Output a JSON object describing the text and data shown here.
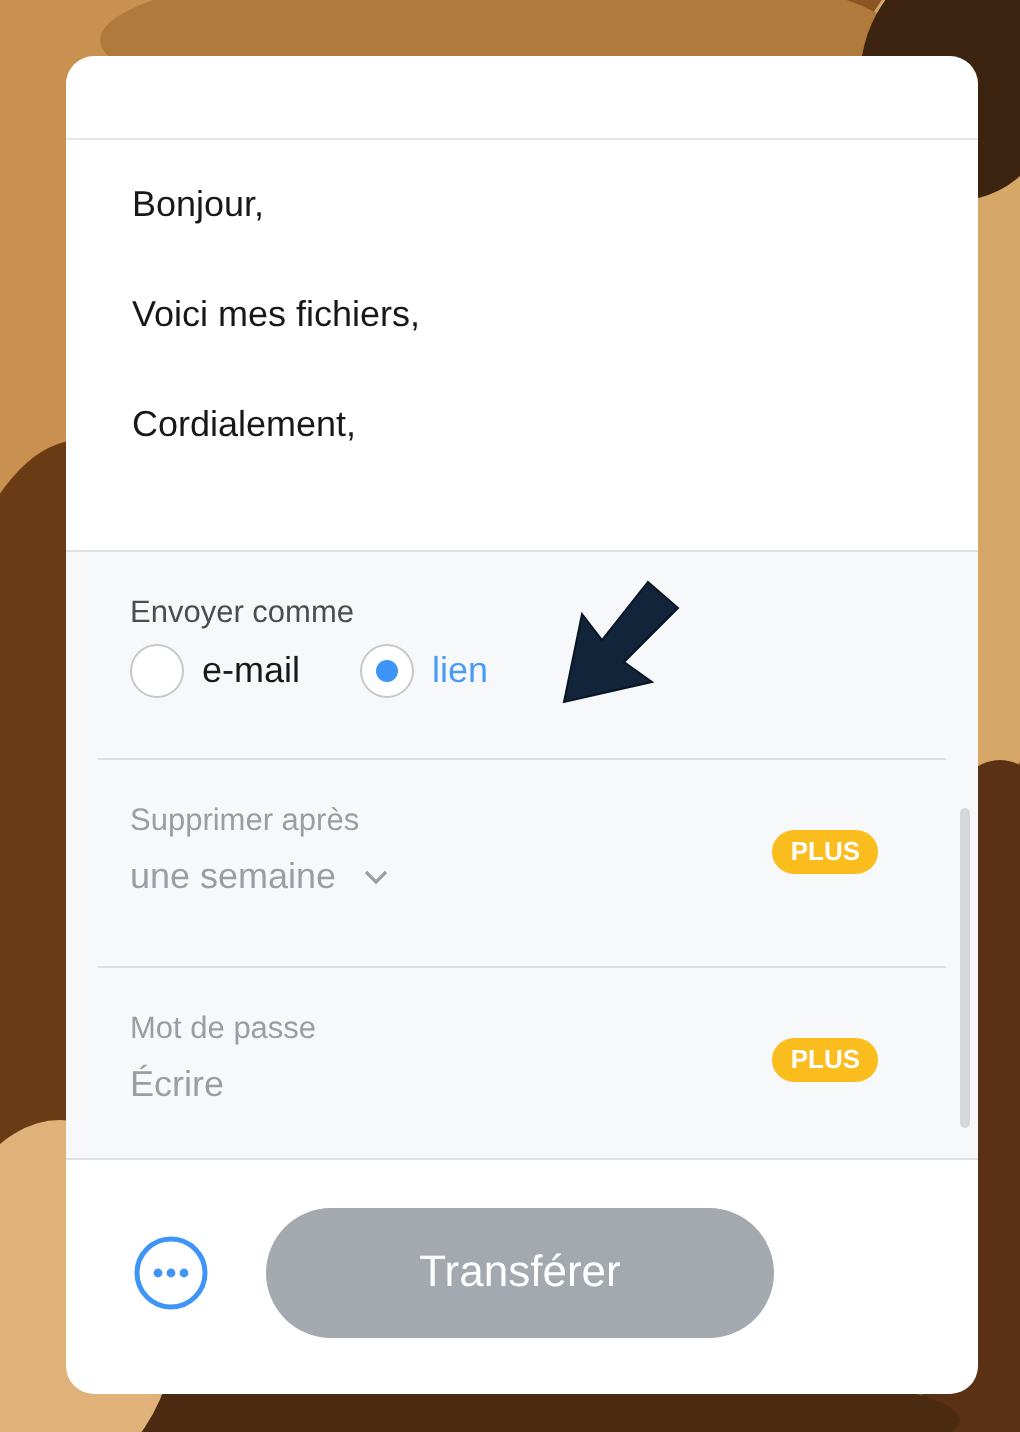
{
  "message": {
    "lines": [
      "Bonjour,",
      "Voici mes fichiers,",
      "Cordialement,"
    ]
  },
  "send_as": {
    "label": "Envoyer comme",
    "options": [
      {
        "label": "e-mail",
        "selected": false
      },
      {
        "label": "lien",
        "selected": true
      }
    ]
  },
  "settings": [
    {
      "kind": "dropdown",
      "label": "Supprimer après",
      "value": "une semaine",
      "badge": "PLUS",
      "disabled": true
    },
    {
      "kind": "text",
      "label": "Mot de passe",
      "placeholder": "Écrire",
      "badge": "PLUS",
      "disabled": true
    }
  ],
  "footer": {
    "submit": {
      "label": "Transférer",
      "disabled": true
    }
  }
}
